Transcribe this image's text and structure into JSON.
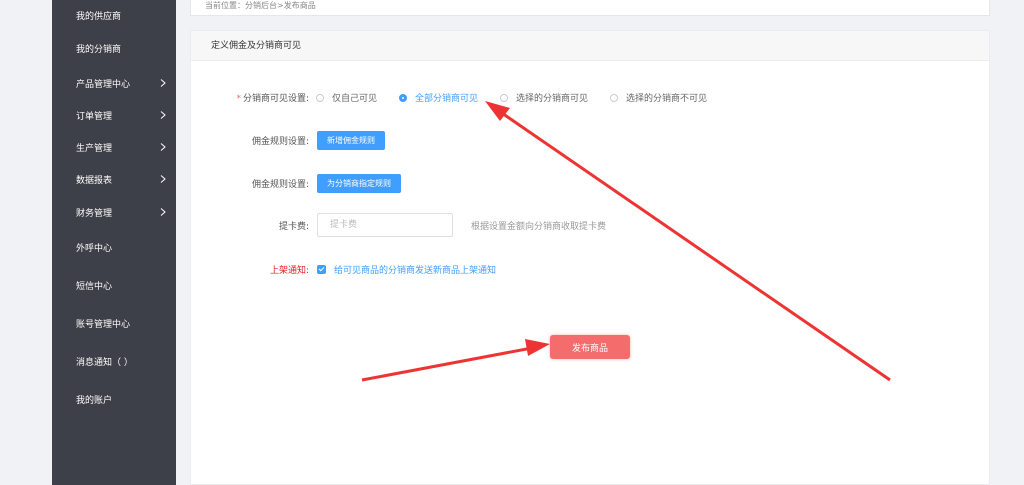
{
  "sidebar": {
    "items": [
      {
        "label": "我的供应商",
        "has_submenu": false
      },
      {
        "label": "我的分销商",
        "has_submenu": false
      },
      {
        "label": "产品管理中心",
        "has_submenu": true
      },
      {
        "label": "订单管理",
        "has_submenu": true
      },
      {
        "label": "生产管理",
        "has_submenu": true
      },
      {
        "label": "数据报表",
        "has_submenu": true
      },
      {
        "label": "财务管理",
        "has_submenu": true
      },
      {
        "label": "外呼中心",
        "has_submenu": false
      },
      {
        "label": "短信中心",
        "has_submenu": false
      },
      {
        "label": "账号管理中心",
        "has_submenu": false
      },
      {
        "label": "消息通知（ ）",
        "has_submenu": false
      },
      {
        "label": "我的账户",
        "has_submenu": false
      }
    ]
  },
  "breadcrumb": "当前位置：分销后台>发布商品",
  "panel": {
    "title": "定义佣金及分销商可见"
  },
  "form": {
    "visibility": {
      "required_mark": "*",
      "label": "分销商可见设置:",
      "options": [
        {
          "label": "仅自己可见",
          "checked": false
        },
        {
          "label": "全部分销商可见",
          "checked": true
        },
        {
          "label": "选择的分销商可见",
          "checked": false
        },
        {
          "label": "选择的分销商不可见",
          "checked": false
        }
      ]
    },
    "commission_rule_1": {
      "label": "佣金规则设置:",
      "button": "新增佣金规则"
    },
    "commission_rule_2": {
      "label": "佣金规则设置:",
      "button": "为分销商指定规则"
    },
    "withdraw_fee": {
      "label": "提卡费:",
      "placeholder": "提卡费",
      "value": "",
      "hint": "根据设置金额向分销商收取提卡费"
    },
    "listing_notice": {
      "label": "上架通知:",
      "checked": true,
      "text": "给可见商品的分销商发送新商品上架通知"
    }
  },
  "publish_button": "发布商品",
  "colors": {
    "sidebar_bg": "#3d4048",
    "primary": "#409eff",
    "danger": "#f56c6c",
    "annotation_arrow": "#ee3333"
  }
}
